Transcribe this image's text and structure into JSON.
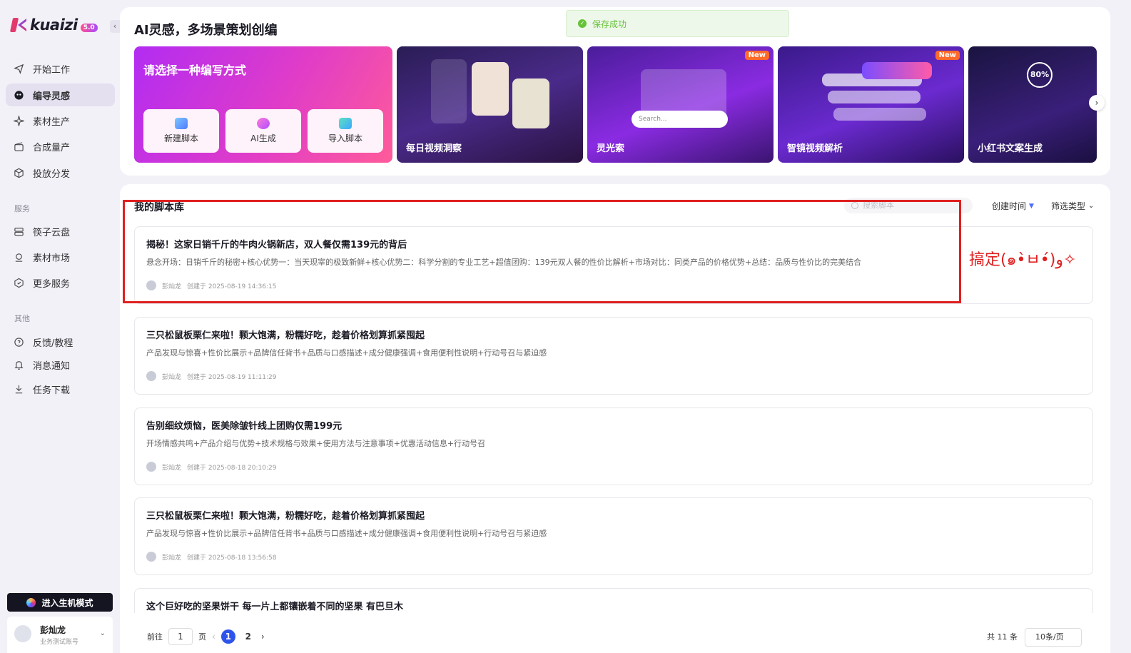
{
  "app": {
    "logo_text": "kuaizi",
    "version": "5.0"
  },
  "sidebar": {
    "items": [
      {
        "label": "开始工作",
        "icon": "send-icon"
      },
      {
        "label": "编导灵感",
        "icon": "inspiration-icon",
        "active": true
      },
      {
        "label": "素材生产",
        "icon": "sparkle-icon"
      },
      {
        "label": "合成量产",
        "icon": "clapper-icon"
      },
      {
        "label": "投放分发",
        "icon": "cube-icon"
      }
    ],
    "section_services": "服务",
    "services": [
      {
        "label": "筷子云盘",
        "icon": "drive-icon"
      },
      {
        "label": "素材市场",
        "icon": "market-icon"
      },
      {
        "label": "更多服务",
        "icon": "hexagon-icon"
      }
    ],
    "section_other": "其他",
    "other": [
      {
        "label": "反馈/教程",
        "icon": "chat-icon"
      },
      {
        "label": "消息通知",
        "icon": "bell-icon"
      },
      {
        "label": "任务下载",
        "icon": "download-icon"
      }
    ],
    "cta_label": "进入生机模式",
    "user": {
      "name": "彭灿龙",
      "subtitle": "业务测试账号"
    }
  },
  "top": {
    "title": "AI灵感，多场景策划创编",
    "toast": "保存成功",
    "main_card": {
      "title": "请选择一种编写方式",
      "options": [
        "新建脚本",
        "AI生成",
        "导入脚本"
      ]
    },
    "cards": [
      {
        "label": "每日视频洞察",
        "badge": ""
      },
      {
        "label": "灵光索",
        "badge": "New",
        "search_placeholder": "Search..."
      },
      {
        "label": "智镜视频解析",
        "badge": "New"
      },
      {
        "label": "小红书文案生成",
        "badge": "",
        "percent": "80%"
      }
    ]
  },
  "library": {
    "title": "我的脚本库",
    "search_placeholder": "搜索脚本",
    "sort_label": "创建时间",
    "filter_label": "筛选类型",
    "scripts": [
      {
        "title": "揭秘！这家日销千斤的牛肉火锅新店，双人餐仅需139元的背后",
        "desc": "悬念开场：日销千斤的秘密+核心优势一：当天现宰的极致新鲜+核心优势二：科学分割的专业工艺+超值团购：139元双人餐的性价比解析+市场对比：同类产品的价格优势+总结：品质与性价比的完美结合",
        "author": "彭灿龙",
        "created": "创建于 2025-08-19 14:36:15"
      },
      {
        "title": "三只松鼠板栗仁来啦！颗大饱满，粉糯好吃，趁着价格划算抓紧囤起",
        "desc": "产品发现与惊喜+性价比展示+品牌信任背书+品质与口感描述+成分健康强调+食用便利性说明+行动号召与紧迫感",
        "author": "彭灿龙",
        "created": "创建于 2025-08-19 11:11:29"
      },
      {
        "title": "告别细纹烦恼，医美除皱针线上团购仅需199元",
        "desc": "开场情感共鸣+产品介绍与优势+技术规格与效果+使用方法与注意事项+优惠活动信息+行动号召",
        "author": "彭灿龙",
        "created": "创建于 2025-08-18 20:10:29"
      },
      {
        "title": "三只松鼠板栗仁来啦！颗大饱满，粉糯好吃，趁着价格划算抓紧囤起",
        "desc": "产品发现与惊喜+性价比展示+品牌信任背书+品质与口感描述+成分健康强调+食用便利性说明+行动号召与紧迫感",
        "author": "彭灿龙",
        "created": "创建于 2025-08-18 13:56:58"
      },
      {
        "title": "这个巨好吃的坚果饼干 每一片上都镶嵌着不同的坚果 有巴旦木",
        "desc": "",
        "author": "",
        "created": ""
      }
    ],
    "annotation": "搞定(๑•̀ㅂ•́)و✧"
  },
  "pagination": {
    "goto_prefix": "前往",
    "goto_value": "1",
    "goto_suffix": "页",
    "pages": [
      "1",
      "2"
    ],
    "current": "1",
    "total": "共 11 条",
    "page_size": "10条/页"
  },
  "colors": {
    "accent": "#2f54eb",
    "annotation": "#e02020",
    "success": "#67c23a"
  }
}
